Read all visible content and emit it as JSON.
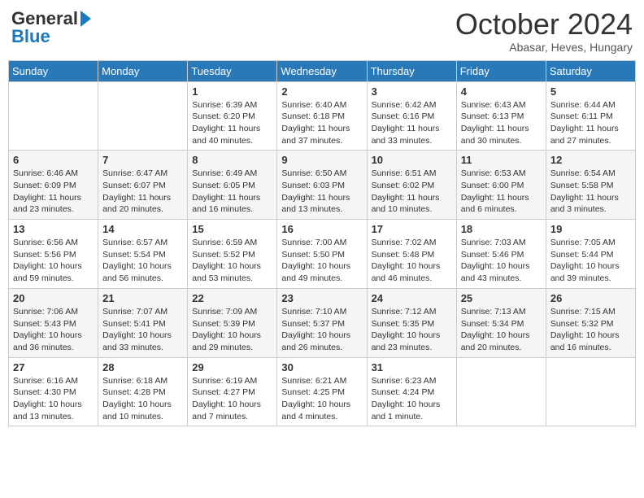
{
  "header": {
    "logo_general": "General",
    "logo_blue": "Blue",
    "month_title": "October 2024",
    "location": "Abasar, Heves, Hungary"
  },
  "weekdays": [
    "Sunday",
    "Monday",
    "Tuesday",
    "Wednesday",
    "Thursday",
    "Friday",
    "Saturday"
  ],
  "weeks": [
    [
      {
        "day": "",
        "info": ""
      },
      {
        "day": "",
        "info": ""
      },
      {
        "day": "1",
        "info": "Sunrise: 6:39 AM\nSunset: 6:20 PM\nDaylight: 11 hours and 40 minutes."
      },
      {
        "day": "2",
        "info": "Sunrise: 6:40 AM\nSunset: 6:18 PM\nDaylight: 11 hours and 37 minutes."
      },
      {
        "day": "3",
        "info": "Sunrise: 6:42 AM\nSunset: 6:16 PM\nDaylight: 11 hours and 33 minutes."
      },
      {
        "day": "4",
        "info": "Sunrise: 6:43 AM\nSunset: 6:13 PM\nDaylight: 11 hours and 30 minutes."
      },
      {
        "day": "5",
        "info": "Sunrise: 6:44 AM\nSunset: 6:11 PM\nDaylight: 11 hours and 27 minutes."
      }
    ],
    [
      {
        "day": "6",
        "info": "Sunrise: 6:46 AM\nSunset: 6:09 PM\nDaylight: 11 hours and 23 minutes."
      },
      {
        "day": "7",
        "info": "Sunrise: 6:47 AM\nSunset: 6:07 PM\nDaylight: 11 hours and 20 minutes."
      },
      {
        "day": "8",
        "info": "Sunrise: 6:49 AM\nSunset: 6:05 PM\nDaylight: 11 hours and 16 minutes."
      },
      {
        "day": "9",
        "info": "Sunrise: 6:50 AM\nSunset: 6:03 PM\nDaylight: 11 hours and 13 minutes."
      },
      {
        "day": "10",
        "info": "Sunrise: 6:51 AM\nSunset: 6:02 PM\nDaylight: 11 hours and 10 minutes."
      },
      {
        "day": "11",
        "info": "Sunrise: 6:53 AM\nSunset: 6:00 PM\nDaylight: 11 hours and 6 minutes."
      },
      {
        "day": "12",
        "info": "Sunrise: 6:54 AM\nSunset: 5:58 PM\nDaylight: 11 hours and 3 minutes."
      }
    ],
    [
      {
        "day": "13",
        "info": "Sunrise: 6:56 AM\nSunset: 5:56 PM\nDaylight: 10 hours and 59 minutes."
      },
      {
        "day": "14",
        "info": "Sunrise: 6:57 AM\nSunset: 5:54 PM\nDaylight: 10 hours and 56 minutes."
      },
      {
        "day": "15",
        "info": "Sunrise: 6:59 AM\nSunset: 5:52 PM\nDaylight: 10 hours and 53 minutes."
      },
      {
        "day": "16",
        "info": "Sunrise: 7:00 AM\nSunset: 5:50 PM\nDaylight: 10 hours and 49 minutes."
      },
      {
        "day": "17",
        "info": "Sunrise: 7:02 AM\nSunset: 5:48 PM\nDaylight: 10 hours and 46 minutes."
      },
      {
        "day": "18",
        "info": "Sunrise: 7:03 AM\nSunset: 5:46 PM\nDaylight: 10 hours and 43 minutes."
      },
      {
        "day": "19",
        "info": "Sunrise: 7:05 AM\nSunset: 5:44 PM\nDaylight: 10 hours and 39 minutes."
      }
    ],
    [
      {
        "day": "20",
        "info": "Sunrise: 7:06 AM\nSunset: 5:43 PM\nDaylight: 10 hours and 36 minutes."
      },
      {
        "day": "21",
        "info": "Sunrise: 7:07 AM\nSunset: 5:41 PM\nDaylight: 10 hours and 33 minutes."
      },
      {
        "day": "22",
        "info": "Sunrise: 7:09 AM\nSunset: 5:39 PM\nDaylight: 10 hours and 29 minutes."
      },
      {
        "day": "23",
        "info": "Sunrise: 7:10 AM\nSunset: 5:37 PM\nDaylight: 10 hours and 26 minutes."
      },
      {
        "day": "24",
        "info": "Sunrise: 7:12 AM\nSunset: 5:35 PM\nDaylight: 10 hours and 23 minutes."
      },
      {
        "day": "25",
        "info": "Sunrise: 7:13 AM\nSunset: 5:34 PM\nDaylight: 10 hours and 20 minutes."
      },
      {
        "day": "26",
        "info": "Sunrise: 7:15 AM\nSunset: 5:32 PM\nDaylight: 10 hours and 16 minutes."
      }
    ],
    [
      {
        "day": "27",
        "info": "Sunrise: 6:16 AM\nSunset: 4:30 PM\nDaylight: 10 hours and 13 minutes."
      },
      {
        "day": "28",
        "info": "Sunrise: 6:18 AM\nSunset: 4:28 PM\nDaylight: 10 hours and 10 minutes."
      },
      {
        "day": "29",
        "info": "Sunrise: 6:19 AM\nSunset: 4:27 PM\nDaylight: 10 hours and 7 minutes."
      },
      {
        "day": "30",
        "info": "Sunrise: 6:21 AM\nSunset: 4:25 PM\nDaylight: 10 hours and 4 minutes."
      },
      {
        "day": "31",
        "info": "Sunrise: 6:23 AM\nSunset: 4:24 PM\nDaylight: 10 hours and 1 minute."
      },
      {
        "day": "",
        "info": ""
      },
      {
        "day": "",
        "info": ""
      }
    ]
  ]
}
